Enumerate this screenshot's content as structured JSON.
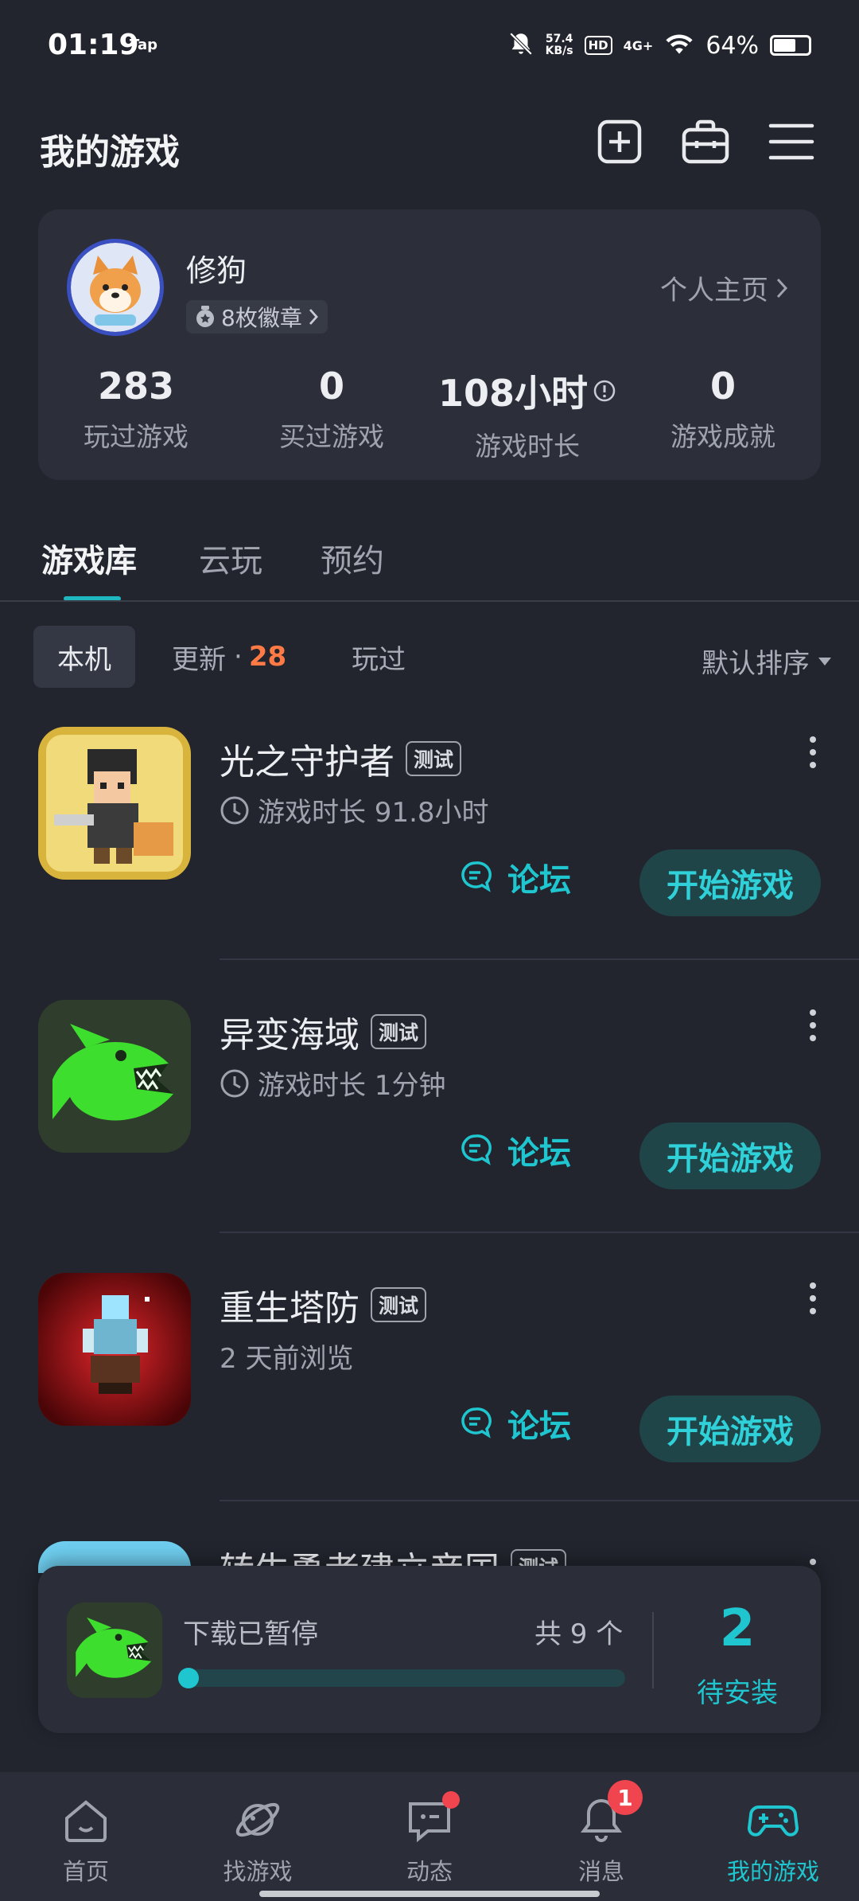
{
  "status_bar": {
    "time": "01:19",
    "tap_label": "Tap",
    "net_speed_value": "57.4",
    "net_speed_unit": "KB/s",
    "hd": "HD",
    "signal": "4G+",
    "battery_percent": "64%",
    "battery_level": 0.64
  },
  "header": {
    "title": "我的游戏",
    "icons": [
      "add-icon",
      "toolbox-icon",
      "menu-icon"
    ]
  },
  "profile": {
    "username": "修狗",
    "badges": "8枚徽章",
    "profile_link": "个人主页",
    "stats": [
      {
        "value": "283",
        "label": "玩过游戏"
      },
      {
        "value": "0",
        "label": "买过游戏"
      },
      {
        "value": "108小时",
        "label": "游戏时长"
      },
      {
        "value": "0",
        "label": "游戏成就"
      }
    ]
  },
  "tabs": [
    {
      "label": "游戏库",
      "active": true
    },
    {
      "label": "云玩",
      "active": false
    },
    {
      "label": "预约",
      "active": false
    }
  ],
  "filters": {
    "local": "本机",
    "update": "更新",
    "update_sep": "·",
    "update_count": "28",
    "played": "玩过",
    "sort": "默认排序"
  },
  "games": [
    {
      "name": "光之守护者",
      "tag": "测试",
      "meta": "游戏时长 91.8小时",
      "forum": "论坛",
      "play": "开始游戏"
    },
    {
      "name": "异变海域",
      "tag": "测试",
      "meta": "游戏时长 1分钟",
      "forum": "论坛",
      "play": "开始游戏"
    },
    {
      "name": "重生塔防",
      "tag": "测试",
      "meta": "2 天前浏览",
      "forum": "论坛",
      "play": "开始游戏"
    },
    {
      "name": "转生勇者建立帝国",
      "tag": "测试"
    }
  ],
  "download": {
    "status": "下载已暂停",
    "count": "共 9 个",
    "pending_count": "2",
    "pending_label": "待安装"
  },
  "bottom_nav": [
    {
      "label": "首页",
      "icon": "home-icon"
    },
    {
      "label": "找游戏",
      "icon": "planet-icon"
    },
    {
      "label": "动态",
      "icon": "chat-icon"
    },
    {
      "label": "消息",
      "icon": "bell-icon",
      "badge": "1"
    },
    {
      "label": "我的游戏",
      "icon": "gamepad-icon",
      "active": true
    }
  ],
  "colors": {
    "background": "#22252e",
    "accent": "#1fc6cf",
    "update_count": "#ff7a45",
    "badge": "#f0454f"
  }
}
